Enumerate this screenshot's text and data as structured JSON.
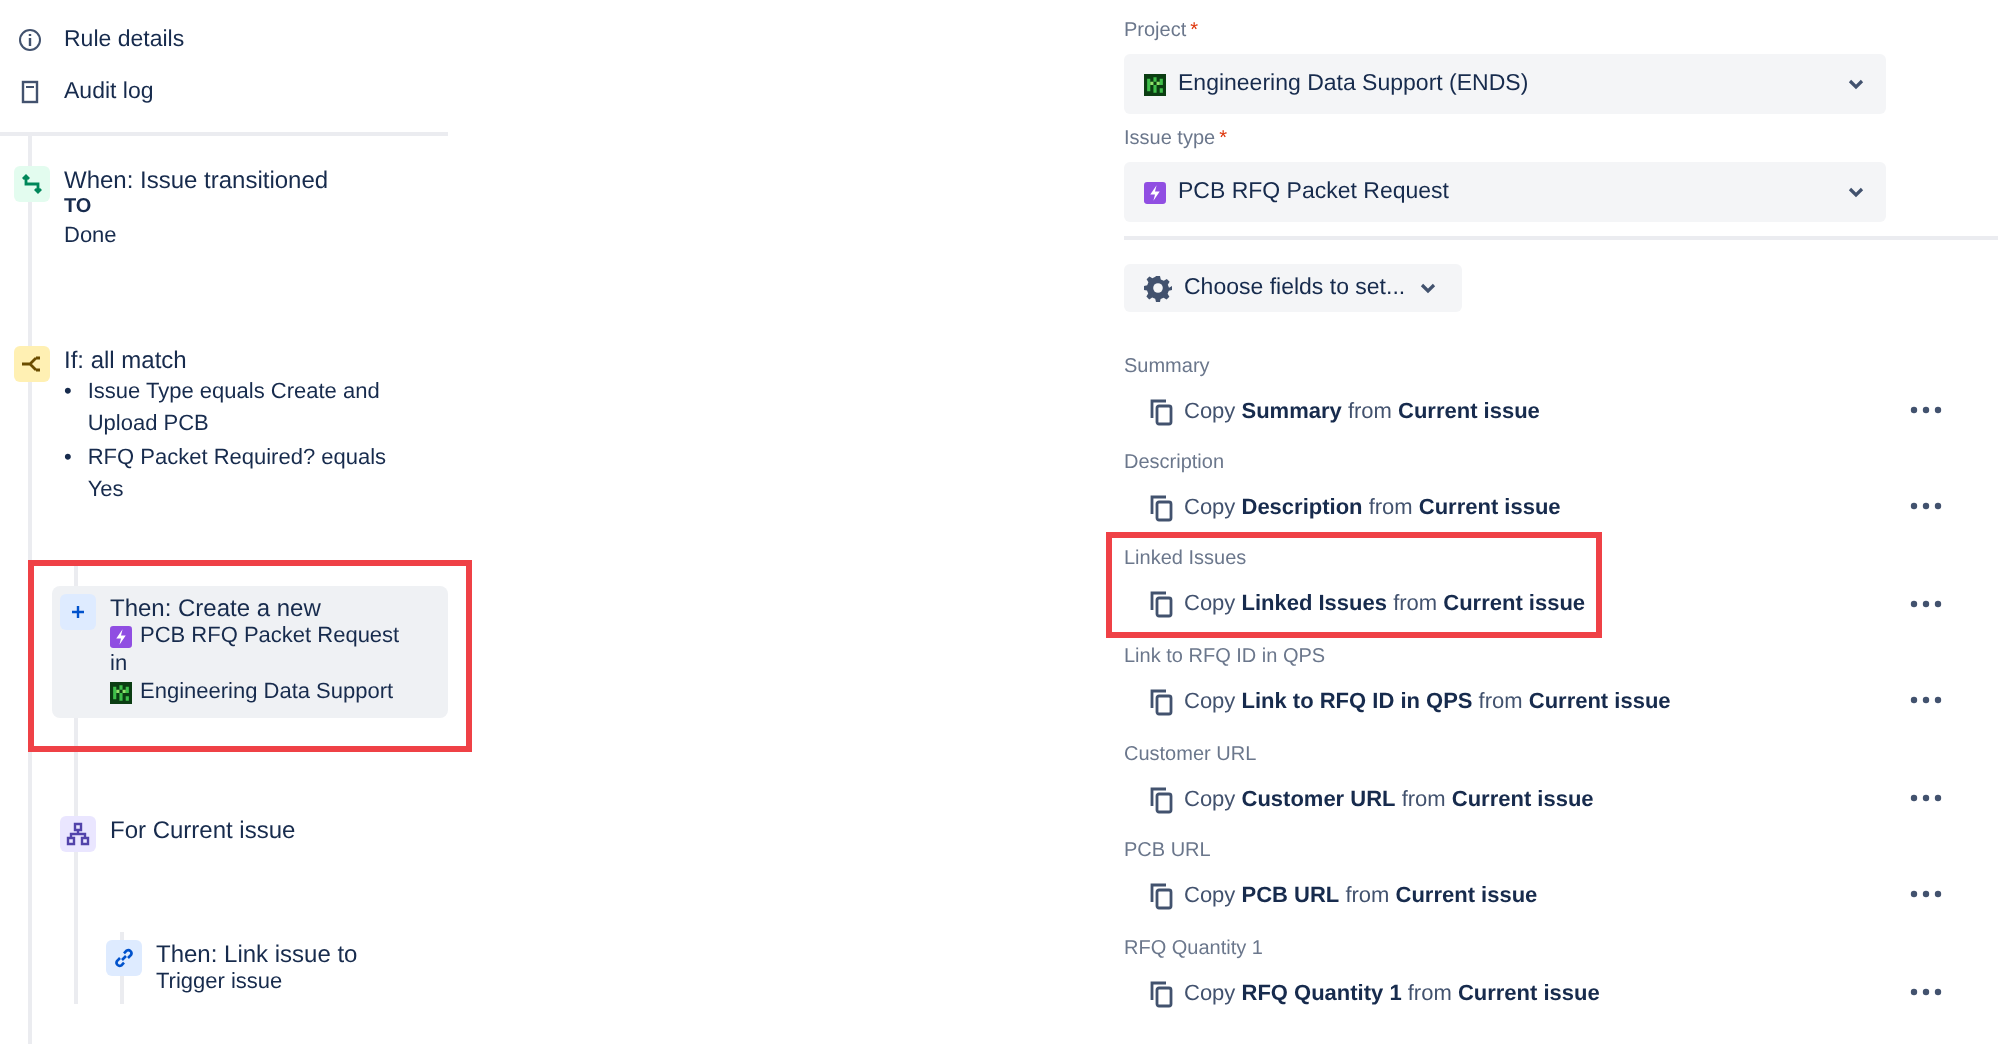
{
  "nav": [
    {
      "kind": "info",
      "label": "Rule details"
    },
    {
      "kind": "document",
      "label": "Audit log"
    }
  ],
  "steps": [
    {
      "kind": "trigger",
      "title": "When: Issue transitioned",
      "selected": false,
      "highlighted": false,
      "lines": [
        {
          "kind": "keyword",
          "text": "TO"
        },
        {
          "kind": "plain",
          "text": "Done"
        }
      ]
    },
    {
      "kind": "condition",
      "title": "If: all match",
      "selected": false,
      "highlighted": false,
      "bullets": [
        {
          "marker": "•",
          "text": "Issue Type equals Create and Upload PCB"
        },
        {
          "marker": "•",
          "text": "RFQ Packet Required? equals Yes"
        }
      ],
      "children": [
        {
          "kind": "action",
          "title": "Then: Create a new",
          "selected": true,
          "highlighted": true,
          "lines": [
            {
              "kind": "issue-type",
              "text": "PCB RFQ Packet Request"
            },
            {
              "kind": "plain",
              "text": "in"
            },
            {
              "kind": "project",
              "text": "Engineering Data Support"
            }
          ]
        },
        {
          "kind": "branch",
          "title": "For Current issue",
          "selected": false,
          "highlighted": false,
          "children": [
            {
              "kind": "link",
              "title": "Then: Link issue to",
              "selected": false,
              "highlighted": false,
              "lines": [
                {
                  "kind": "plain",
                  "text": "Trigger issue"
                }
              ]
            }
          ]
        }
      ]
    }
  ],
  "project": {
    "label": "Project",
    "required_mark": "*",
    "value": "Engineering Data Support (ENDS)"
  },
  "issue_type": {
    "label": "Issue type",
    "required_mark": "*",
    "value": "PCB RFQ Packet Request"
  },
  "choose_fields": {
    "label": "Choose fields to set..."
  },
  "fields": [
    {
      "label": "Summary",
      "action": "Copy **Summary** from **Current issue**",
      "highlighted": false
    },
    {
      "label": "Description",
      "action": "Copy **Description** from **Current issue**",
      "highlighted": false
    },
    {
      "label": "Linked Issues",
      "action": "Copy **Linked Issues** from **Current issue**",
      "highlighted": true
    },
    {
      "label": "Link to RFQ ID in QPS",
      "action": "Copy **Link to RFQ ID in QPS** from **Current issue**",
      "highlighted": false
    },
    {
      "label": "Customer URL",
      "action": "Copy **Customer URL** from **Current issue**",
      "highlighted": false
    },
    {
      "label": "PCB URL",
      "action": "Copy **PCB URL** from **Current issue**",
      "highlighted": false
    },
    {
      "label": "RFQ Quantity 1",
      "action": "Copy **RFQ Quantity 1** from **Current issue**",
      "highlighted": false
    }
  ]
}
